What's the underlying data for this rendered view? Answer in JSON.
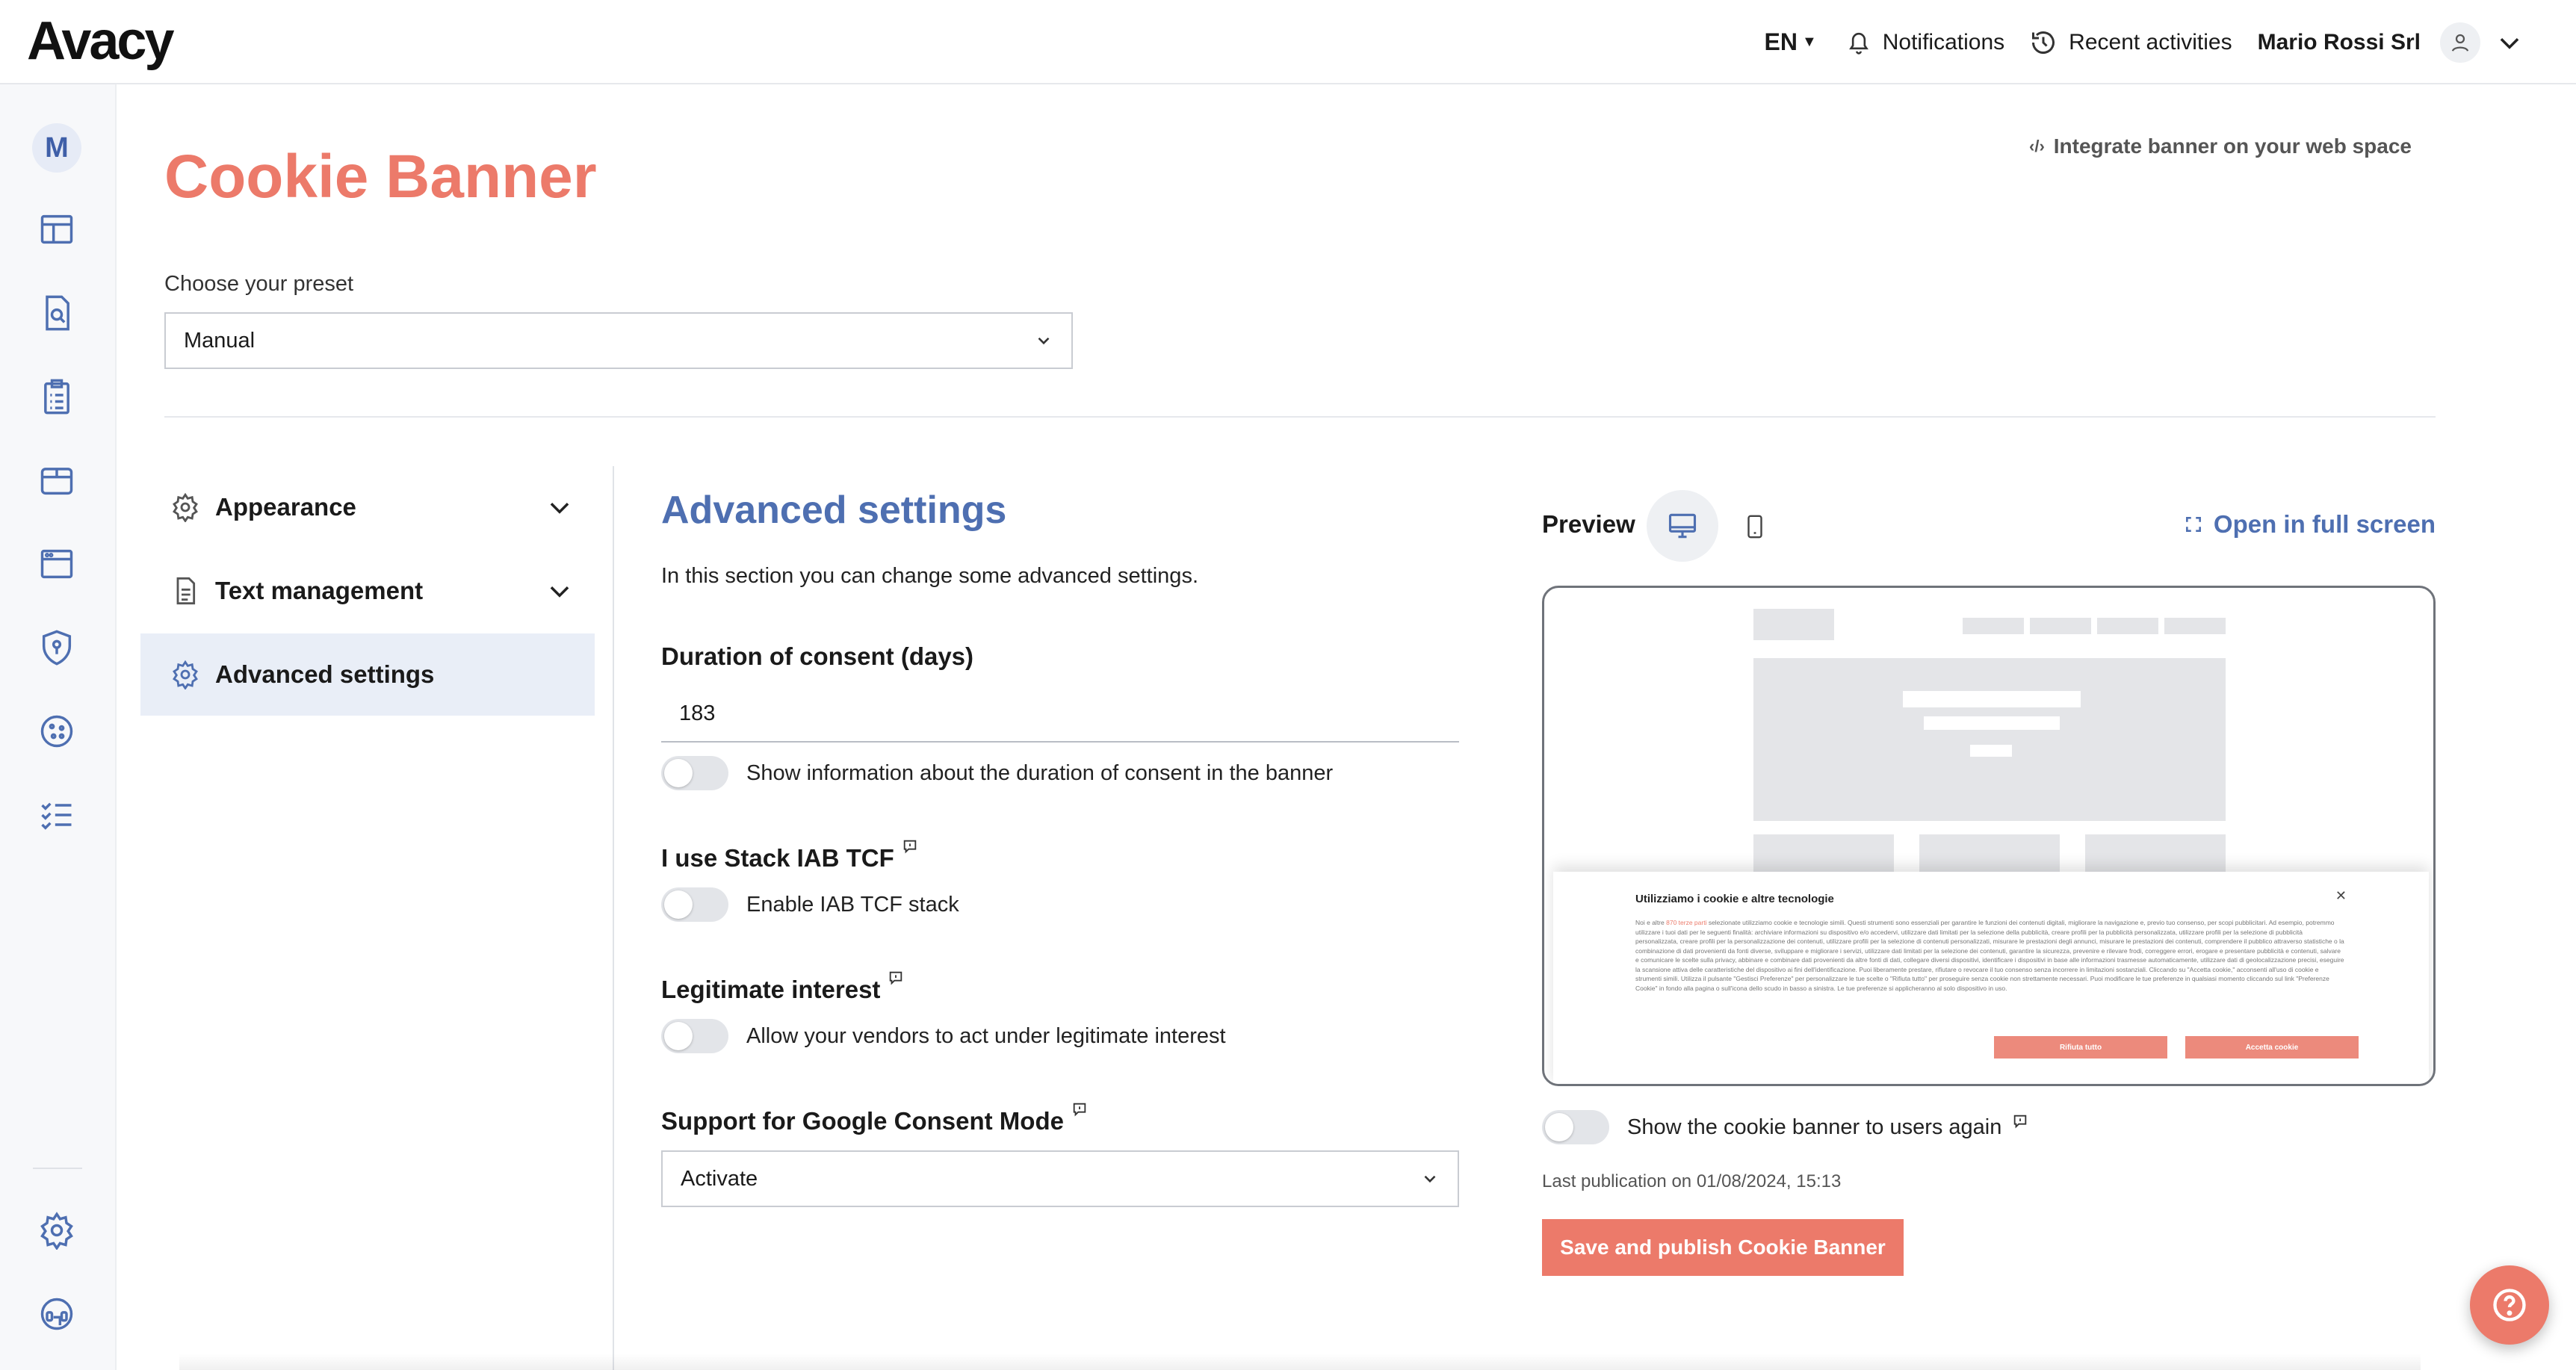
{
  "header": {
    "logo": "Avacy",
    "language": "EN",
    "notifications_label": "Notifications",
    "recent_label": "Recent activities",
    "user_name": "Mario Rossi Srl"
  },
  "sidebar": {
    "avatar_initial": "M",
    "icons": [
      "dashboard-icon",
      "document-search-icon",
      "clipboard-list-icon",
      "box-icon",
      "browser-window-icon",
      "shield-icon",
      "cookie-icon",
      "checklist-icon",
      "gear-icon",
      "headset-icon"
    ]
  },
  "page": {
    "title": "Cookie Banner",
    "integrate_link": "Integrate banner on your web space",
    "preset_label": "Choose your preset",
    "preset_value": "Manual"
  },
  "menu": {
    "items": [
      {
        "label": "Appearance",
        "icon": "gear-icon"
      },
      {
        "label": "Text management",
        "icon": "document-icon"
      },
      {
        "label": "Advanced settings",
        "icon": "gear-icon"
      }
    ]
  },
  "advanced": {
    "title": "Advanced settings",
    "description": "In this section you can change some advanced settings.",
    "duration_title": "Duration of consent (days)",
    "duration_value": "183",
    "duration_toggle_label": "Show information about the duration of consent in the banner",
    "iab_title": "I use Stack IAB TCF",
    "iab_toggle_label": "Enable IAB TCF stack",
    "legit_title": "Legitimate interest",
    "legit_toggle_label": "Allow your vendors to act under legitimate interest",
    "gcm_title": "Support for Google Consent Mode",
    "gcm_value": "Activate"
  },
  "preview": {
    "label": "Preview",
    "fullscreen_label": "Open in full screen",
    "banner_title": "Utilizziamo i cookie e altre tecnologie",
    "banner_text_a": "Noi e altre ",
    "banner_text_hl": "870 terze parti",
    "banner_text_b": " selezionate utilizziamo cookie e tecnologie simili. Questi strumenti sono essenziali per garantire le funzioni dei contenuti digitali, migliorare la navigazione e, previo tuo consenso, per scopi pubblicitari. Ad esempio, potremmo utilizzare i tuoi dati per le seguenti finalità: archiviare informazioni su dispositivo e/o accedervi, utilizzare dati limitati per la selezione della pubblicità, creare profili per la pubblicità personalizzata, utilizzare profili per la selezione di pubblicità personalizzata, creare profili per la personalizzazione dei contenuti, utilizzare profili per la selezione di contenuti personalizzati, misurare le prestazioni degli annunci, misurare le prestazioni dei contenuti, comprendere il pubblico attraverso statistiche o la combinazione di dati provenienti da fonti diverse, sviluppare e migliorare i servizi, utilizzare dati limitati per la selezione dei contenuti, garantire la sicurezza, prevenire e rilevare frodi, correggere errori, erogare e presentare pubblicità e contenuti, salvare e comunicare le scelte sulla privacy, abbinare e combinare dati provenienti da altre fonti di dati, collegare diversi dispositivi, identificare i dispositivi in base alle informazioni trasmesse automaticamente, utilizzare dati di geolocalizzazione precisi, eseguire la scansione attiva delle caratteristiche del dispositivo ai fini dell'identificazione. Puoi liberamente prestare, rifiutare o revocare il tuo consenso senza incorrere in limitazioni sostanziali. Cliccando su \"Accetta cookie,\" acconsenti all'uso di cookie e strumenti simili. Utilizza il pulsante \"Gestisci Preferenze\" per personalizzare le tue scelte o \"Rifiuta tutto\" per proseguire senza cookie non strettamente necessari. Puoi modificare le tue preferenze in qualsiasi momento cliccando sul link \"Preferenze Cookie\" in fondo alla pagina o sull'icona dello scudo in basso a sinistra. Le tue preferenze si applicheranno al solo dispositivo in uso.",
    "reject_label": "Rifiuta tutto",
    "accept_label": "Accetta cookie",
    "show_again_label": "Show the cookie banner to users again",
    "last_publication": "Last publication on 01/08/2024, 15:13",
    "save_label": "Save and publish Cookie Banner"
  },
  "colors": {
    "accent": "#ec7a6a",
    "blue": "#4e6fb1"
  }
}
